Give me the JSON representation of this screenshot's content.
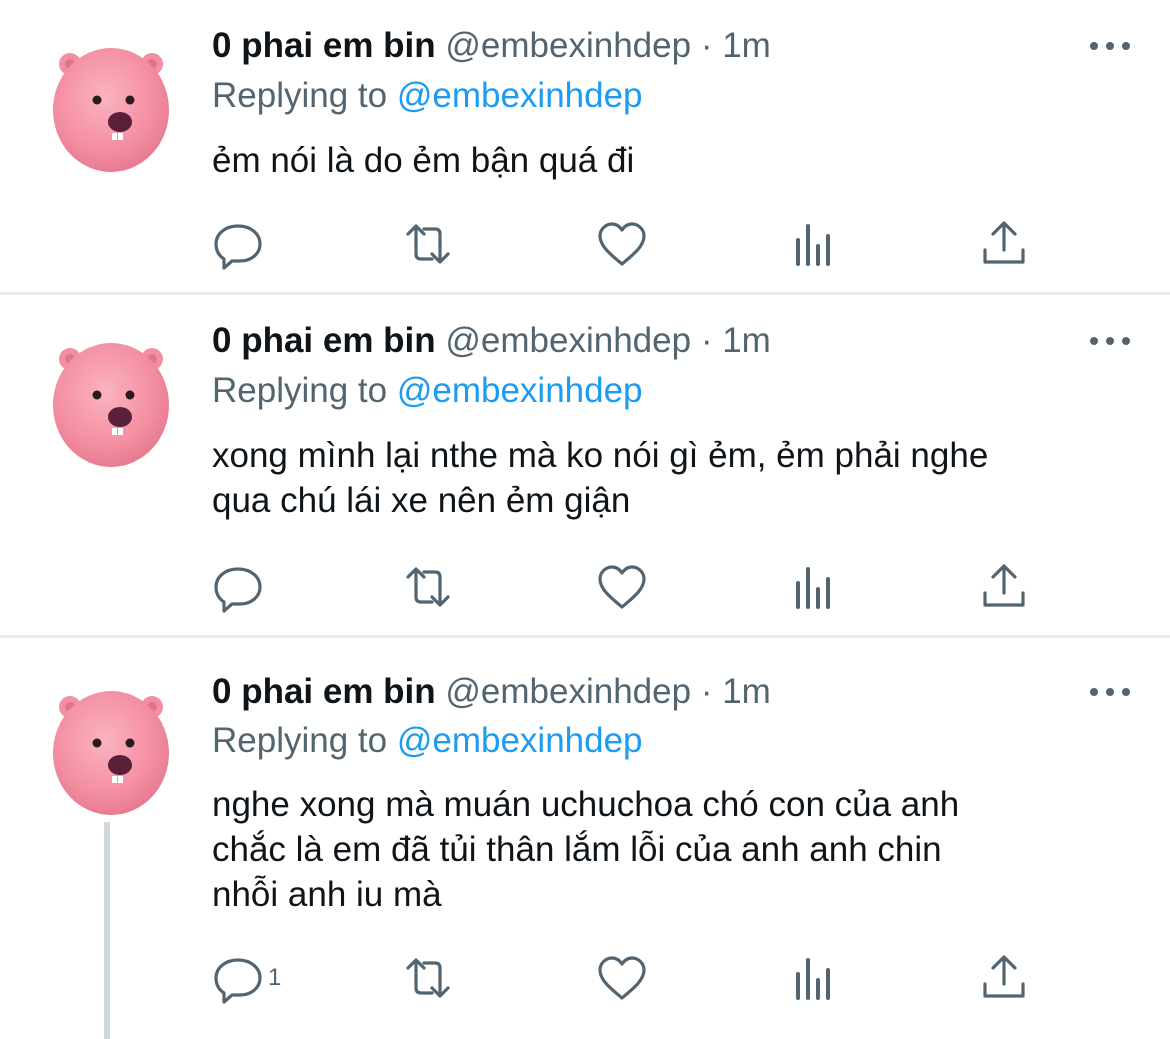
{
  "tweets": [
    {
      "display_name": "0 phai em bin",
      "handle": "@embexinhdep",
      "separator": "·",
      "time": "1m",
      "replying_label": "Replying to",
      "replying_handle": "@embexinhdep",
      "text": "ẻm nói là do ẻm bận quá đi",
      "reply_count": ""
    },
    {
      "display_name": "0 phai em bin",
      "handle": "@embexinhdep",
      "separator": "·",
      "time": "1m",
      "replying_label": "Replying to",
      "replying_handle": "@embexinhdep",
      "text": "xong mình lại nthe mà ko nói gì ẻm, ẻm phải nghe\nqua chú lái xe nên ẻm giận",
      "reply_count": ""
    },
    {
      "display_name": "0 phai em bin",
      "handle": "@embexinhdep",
      "separator": "·",
      "time": "1m",
      "replying_label": "Replying to",
      "replying_handle": "@embexinhdep",
      "text": "nghe xong mà muán uchuchoa chó con của anh\nchắc là em đã tủi thân lắm lỗi của anh anh chin\nnhỗi anh iu mà",
      "reply_count": "1"
    }
  ],
  "icons": {
    "reply": "reply-icon",
    "retweet": "retweet-icon",
    "like": "heart-icon",
    "views": "analytics-icon",
    "share": "share-icon",
    "more": "more-icon"
  },
  "colors": {
    "text": "#0f1419",
    "secondary": "#536471",
    "link": "#1d9bf0",
    "divider": "#e8ebed",
    "avatar_pink": "#f08fa0"
  }
}
